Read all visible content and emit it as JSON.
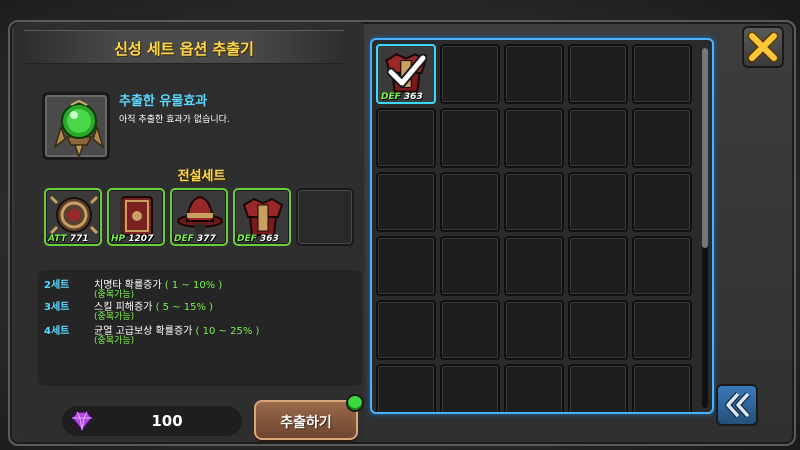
{
  "window": {
    "title": "신성 세트 옵션 추출기"
  },
  "relic": {
    "icon": "green-orb-relic-icon",
    "label": "추출한 유물효과",
    "description": "아직 추출한 효과가 없습니다."
  },
  "set": {
    "name": "전설세트",
    "items": [
      {
        "icon": "spiked-shield-icon",
        "stat_name": "ATT",
        "stat_value": "771"
      },
      {
        "icon": "book-icon",
        "stat_name": "HP",
        "stat_value": "1207"
      },
      {
        "icon": "red-hat-icon",
        "stat_name": "DEF",
        "stat_value": "377"
      },
      {
        "icon": "red-armor-icon",
        "stat_name": "DEF",
        "stat_value": "363"
      }
    ]
  },
  "effects": [
    {
      "tier": "2세트",
      "desc": "치명타 확률증가",
      "range": "( 1 ~ 10% )",
      "note": "(중복가능)"
    },
    {
      "tier": "3세트",
      "desc": "스킬 피해증가",
      "range": "( 5 ~ 15% )",
      "note": "(중복가능)"
    },
    {
      "tier": "4세트",
      "desc": "균열 고급보상 확률증가",
      "range": "( 10 ~ 25% )",
      "note": "(중복가능)"
    }
  ],
  "currency": {
    "icon": "purple-gem-icon",
    "value": "100"
  },
  "extract_button": {
    "label": "추출하기"
  },
  "inventory": {
    "selected_item": {
      "icon": "red-armor-icon",
      "stat_name": "DEF",
      "stat_value": "363",
      "checked": true
    }
  },
  "colors": {
    "accent": "#4ab0ff",
    "gold": "#ffd84a",
    "green": "#7af04a",
    "cyan": "#5ad8ff"
  }
}
